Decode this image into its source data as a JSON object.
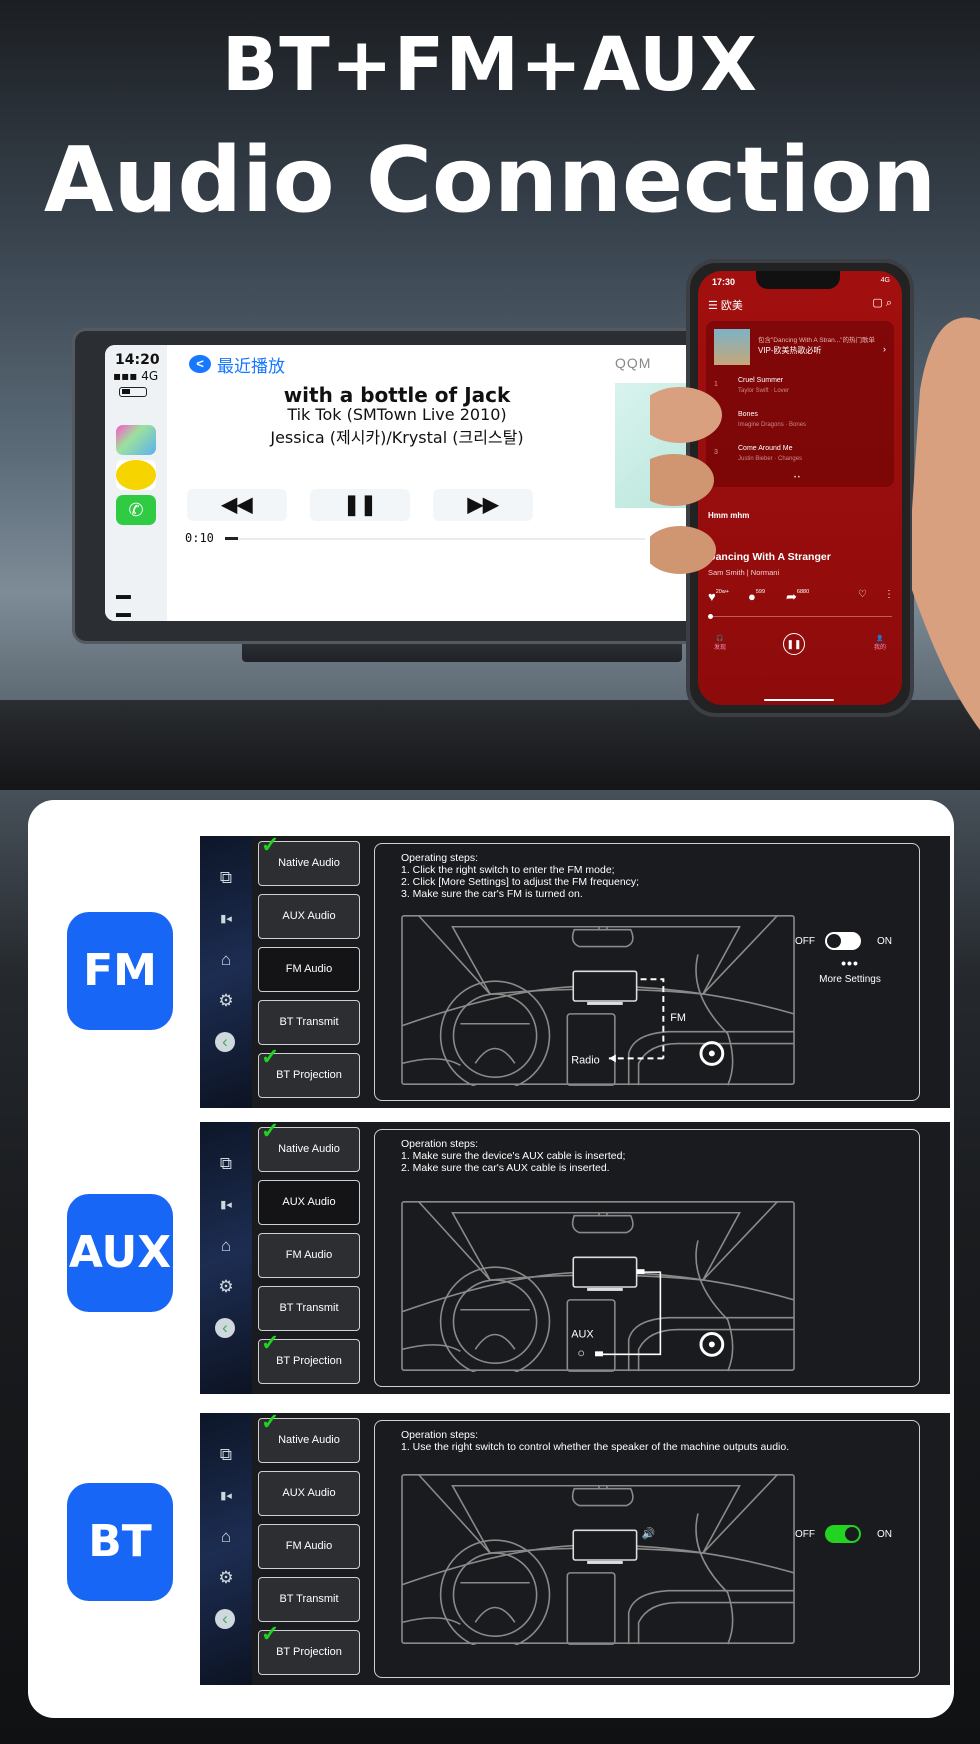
{
  "headline": {
    "line1": "BT+FM+AUX",
    "line2": "Audio Connection"
  },
  "carplay": {
    "time": "14:20",
    "network": "4G",
    "back_label": "<",
    "breadcrumb": "最近播放",
    "app_name": "QQM",
    "lyric": "with a bottle of Jack",
    "song": "Tik Tok (SMTown Live 2010)",
    "artist": "Jessica (제시카)/Krystal (크리스탈)",
    "controls": {
      "prev": "◀◀",
      "pause": "❚❚",
      "next": "▶▶"
    },
    "elapsed": "0:10",
    "progress": 0.03
  },
  "phone": {
    "time": "17:30",
    "signal": "4G",
    "tab": "欧美",
    "playlist_sub": "包含\"Dancing With A Stran...\"的热门歌单",
    "playlist_title": "VIP-欧美热歌必听",
    "songs": [
      {
        "n": "1",
        "title": "Cruel Summer",
        "artist": "Taylor Swift · Lover"
      },
      {
        "n": "2",
        "title": "Bones",
        "artist": "Imagine Dragons · Bones"
      },
      {
        "n": "3",
        "title": "Come Around Me",
        "artist": "Justin Bieber · Changes"
      }
    ],
    "lyric": "Hmm mhm",
    "title": "Dancing With A Stranger",
    "artist": "Sam Smith | Normani",
    "likes": "20w+",
    "comments": "599",
    "shares": "6880",
    "nav": {
      "left": "发现",
      "right": "我的"
    }
  },
  "menu": [
    "Native Audio",
    "AUX Audio",
    "FM Audio",
    "BT Transmit",
    "BT Projection"
  ],
  "panels": {
    "fm": {
      "badge": "FM",
      "steps": [
        "Operating steps:",
        "1. Click the right switch to enter the FM mode;",
        "2. Click [More Settings] to adjust the FM frequency;",
        "3. Make sure the car's FM is turned on."
      ],
      "label_fm": "FM",
      "label_radio": "Radio",
      "switch": {
        "off": "OFF",
        "on": "ON",
        "state": "off"
      },
      "more_settings": "More Settings"
    },
    "aux": {
      "badge": "AUX",
      "steps": [
        "Operation steps:",
        "1. Make sure the device's AUX cable is inserted;",
        "2. Make sure the car's AUX cable is inserted."
      ],
      "label_aux": "AUX"
    },
    "bt": {
      "badge": "BT",
      "steps": [
        "Operation steps:",
        "1. Use the right switch to control whether the speaker of the machine outputs audio."
      ],
      "switch": {
        "off": "OFF",
        "on": "ON",
        "state": "on"
      }
    }
  },
  "colors": {
    "accent": "#1766f5",
    "check": "#1ed41e",
    "toggle_on": "#22d322",
    "phone_bg": "#9b0d0d"
  }
}
